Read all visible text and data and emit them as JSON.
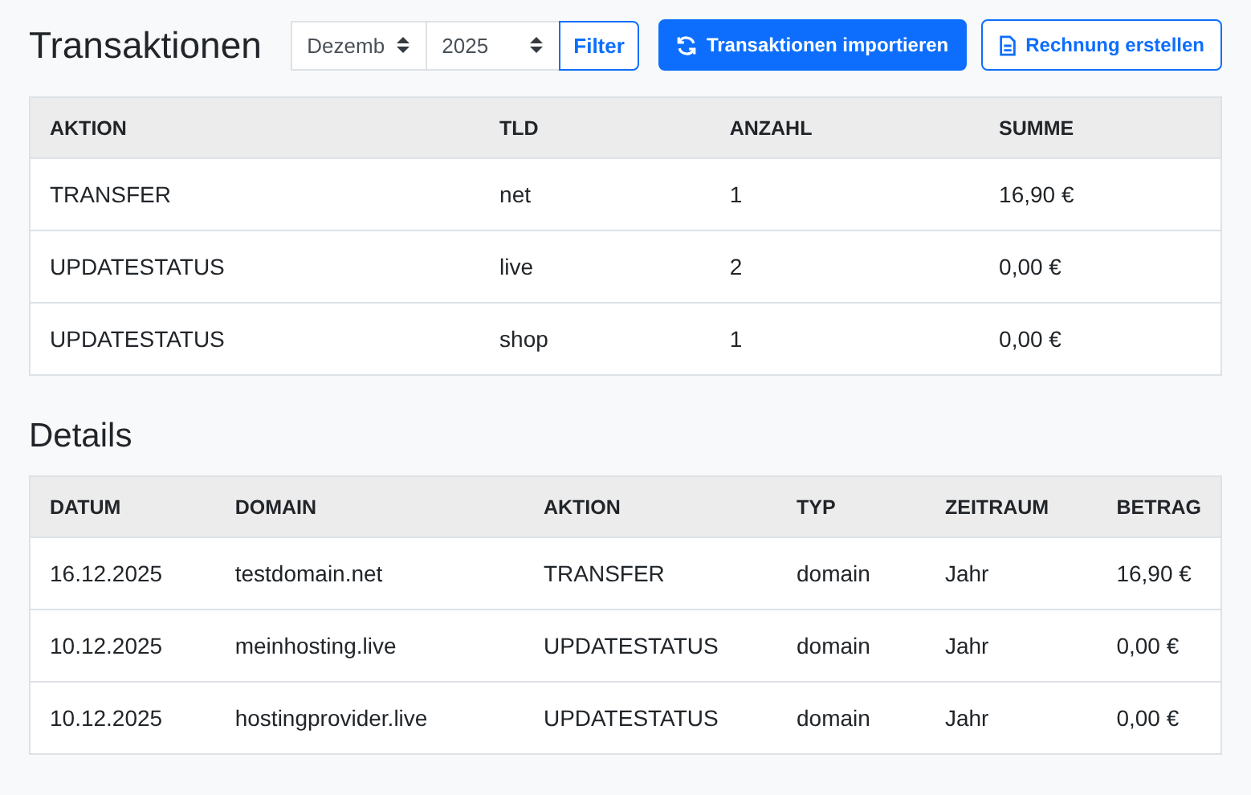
{
  "title": "Transaktionen",
  "toolbar": {
    "month": "Dezemb",
    "year": "2025",
    "filter": "Filter",
    "import": "Transaktionen importieren",
    "invoice": "Rechnung erstellen"
  },
  "summary": {
    "columns": [
      "AKTION",
      "TLD",
      "ANZAHL",
      "SUMME"
    ],
    "rows": [
      [
        "TRANSFER",
        "net",
        "1",
        "16,90 €"
      ],
      [
        "UPDATESTATUS",
        "live",
        "2",
        "0,00 €"
      ],
      [
        "UPDATESTATUS",
        "shop",
        "1",
        "0,00 €"
      ]
    ]
  },
  "details": {
    "title": "Details",
    "columns": [
      "DATUM",
      "DOMAIN",
      "AKTION",
      "TYP",
      "ZEITRAUM",
      "BETRAG"
    ],
    "rows": [
      [
        "16.12.2025",
        "testdomain.net",
        "TRANSFER",
        "domain",
        "Jahr",
        "16,90 €"
      ],
      [
        "10.12.2025",
        "meinhosting.live",
        "UPDATESTATUS",
        "domain",
        "Jahr",
        "0,00 €"
      ],
      [
        "10.12.2025",
        "hostingprovider.live",
        "UPDATESTATUS",
        "domain",
        "Jahr",
        "0,00 €"
      ]
    ]
  }
}
